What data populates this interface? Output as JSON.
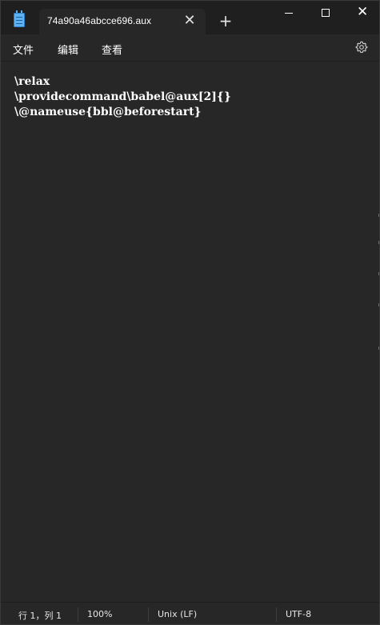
{
  "titlebar": {
    "tab_title": "74a90a46abcce696.aux",
    "close_tab_glyph": "✕",
    "new_tab_glyph": "+",
    "close_glyph": "✕"
  },
  "menu": {
    "file": "文件",
    "edit": "编辑",
    "view": "查看"
  },
  "editor": {
    "content": "\\relax\n\\providecommand\\babel@aux[2]{}\n\\@nameuse{bbl@beforestart}"
  },
  "status": {
    "position": "行 1，列 1",
    "zoom": "100%",
    "line_ending": "Unix (LF)",
    "encoding": "UTF-8"
  },
  "icons": {
    "app": "notepad-icon",
    "settings": "gear-icon"
  },
  "colors": {
    "background": "#272727",
    "titlebar": "#1f1f1f",
    "accent_icon": "#5fb2f2",
    "text": "#ffffff"
  }
}
